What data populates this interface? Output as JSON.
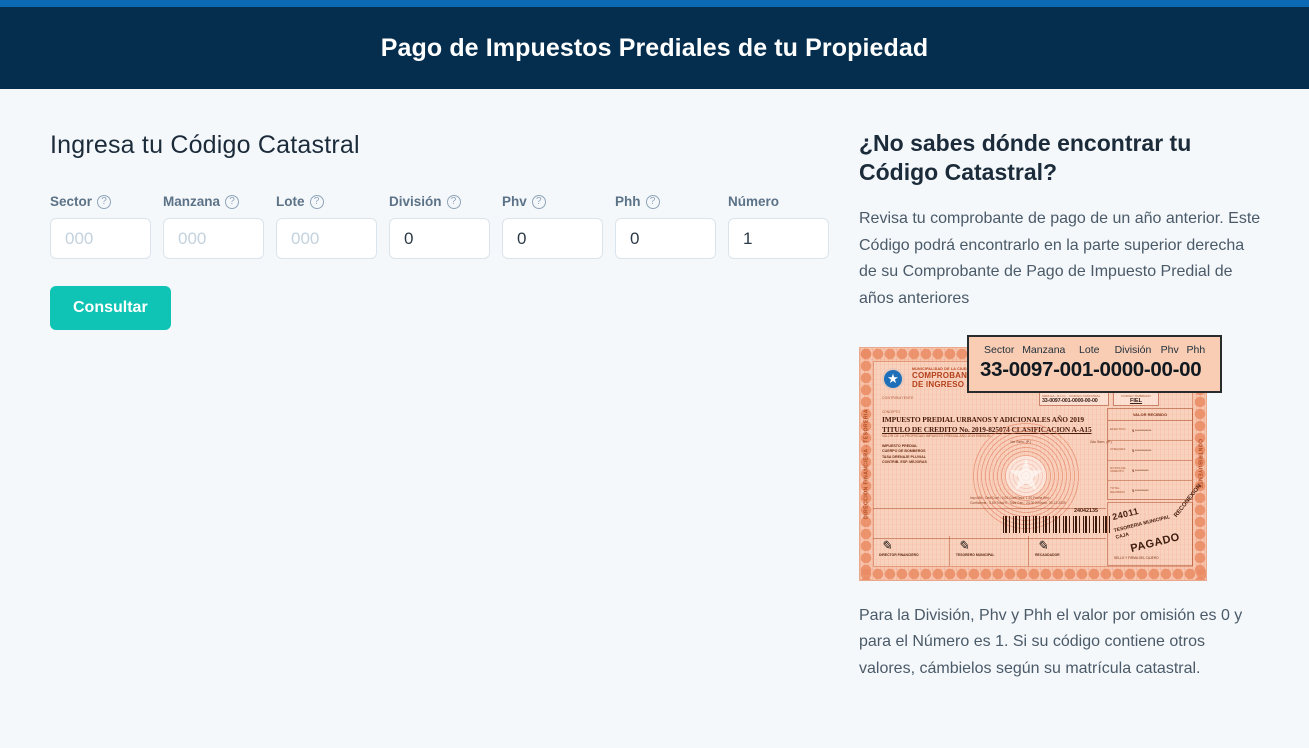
{
  "header": {
    "title": "Pago de Impuestos Prediales de tu Propiedad",
    "accent_color": "#0c6ab5",
    "background_color": "#052e4e"
  },
  "form": {
    "title": "Ingresa tu Código Catastral",
    "help_icon": "?",
    "fields": [
      {
        "label": "Sector",
        "has_help": true,
        "placeholder": "000",
        "value": ""
      },
      {
        "label": "Manzana",
        "has_help": true,
        "placeholder": "000",
        "value": ""
      },
      {
        "label": "Lote",
        "has_help": true,
        "placeholder": "000",
        "value": ""
      },
      {
        "label": "División",
        "has_help": true,
        "placeholder": "",
        "value": "0"
      },
      {
        "label": "Phv",
        "has_help": true,
        "placeholder": "",
        "value": "0"
      },
      {
        "label": "Phh",
        "has_help": true,
        "placeholder": "",
        "value": "0"
      },
      {
        "label": "Número",
        "has_help": false,
        "placeholder": "",
        "value": "1"
      }
    ],
    "submit_label": "Consultar",
    "submit_color": "#0fc4b4"
  },
  "help_panel": {
    "title": "¿No sabes dónde encontrar tu Código Catastral?",
    "paragraph_top": "Revisa tu comprobante de pago de un año anterior. Este Código podrá encontrarlo en la parte superior derecha de su Comprobante de Pago de Impuesto Predial de años anteriores",
    "paragraph_bottom": "Para la División, Phv y Phh el valor por omisión es 0 y para el Número es 1. Si su código contiene otros valores, cámbielos según su matrícula catastral."
  },
  "callout": {
    "headers": [
      "Sector",
      "Manzana",
      "Lote",
      "División",
      "Phv",
      "Phh"
    ],
    "code": "33-0097-001-0000-00-00",
    "background_color": "#f8cdb4",
    "border_color": "#2b2b2b"
  },
  "receipt": {
    "left_strip": "DIRECCION FINANCIERA - TESORERIA",
    "right_strip": "CONTRIBUYENTE",
    "municipality_line": "MUNICIPALIDAD DE LA CIUDAD",
    "head_line_1": "COMPROBANTE",
    "head_line_2": "DE INGRESO A CAJA",
    "contributor_label": "CONTRIBUYENTE",
    "code_box_caption": "CEDULA - R.U.C. - CODIGO CATASTRAL",
    "code_box_value": "33-0097-001-0000-00-00",
    "code_box2_caption": "CODIGO TIMBRADO",
    "code_box2_value": "FIEL",
    "concept_label": "CONCEPTO",
    "title_line_1": "IMPUESTO PREDIAL URBANOS Y ADICIONALES AÑO 2019",
    "title_line_2": "TITULO DE CREDITO No. 2019-825074 CLASIFICACION A-A15",
    "subtitle_line": "VALOR DE LA PROPIEDAD   IMPUESTO PREDIAL   AÑO 2019   EMISION",
    "detail_lines": "IMPUESTO PREDIAL\nCUERPO DE BOMBEROS\nTASA DRENAJE PLUVIAL\nCONTRIB. ESP. MEJORAS",
    "mid_num_1": "1er Sem.  (P.)",
    "mid_num_2": "2do Sem.  (P.)",
    "calc_line": "Imp=Mili.:      Ded/Coef.:      0.00   Coef/Tasa:   1.20   Fecha Emi.:\nCoeficiente :     0.60 Total/ E.    Total Gen.: 24.00  Emisión: 30-12-2009",
    "table_header": "VALOR RECIBIDO",
    "table_rows": [
      {
        "label": "EFECTIVO",
        "value": "$ ************"
      },
      {
        "label": "CHEQUES",
        "value": "$ ************"
      },
      {
        "label": "NOTAS DE CREDITO",
        "value": "$ **********"
      },
      {
        "label": "TOTAL RECIBIDO",
        "value": "$ **********"
      }
    ],
    "barcode_number": "24042135",
    "signatures": [
      {
        "caption": "DIRECTOR FINANCIERO"
      },
      {
        "caption": "TESORERO MUNICIPAL"
      },
      {
        "caption": "RECAUDADOR"
      }
    ],
    "stamp_number": "24011",
    "stamp_text": "TESORERIA MUNICIPAL\nCAJA",
    "stamp_paid": "PAGADO",
    "stamp_caption": "SELLO Y FIRMA DEL CAJERO",
    "reconnect_text": "RECONEXION"
  }
}
